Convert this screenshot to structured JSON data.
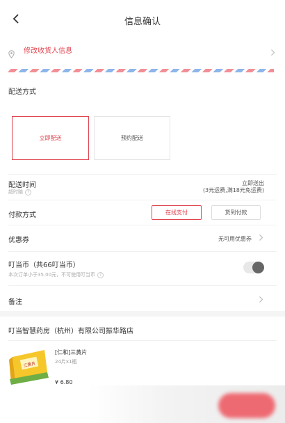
{
  "header": {
    "title": "信息确认",
    "back_icon": "chevron-left-icon"
  },
  "address": {
    "label": "修改收货人信息",
    "icon": "location-pin-icon"
  },
  "delivery": {
    "section_title": "配送方式",
    "options": [
      {
        "label": "立即配送",
        "selected": true
      },
      {
        "label": "预约配送",
        "selected": false
      }
    ]
  },
  "delivery_time": {
    "label": "配送时间",
    "sub_label": "超时赔",
    "value": "立即送出",
    "fee_note": "(3元运费,满18元免运费)"
  },
  "payment": {
    "label": "付款方式",
    "options": [
      {
        "label": "在线支付",
        "selected": true
      },
      {
        "label": "货到付款",
        "selected": false
      }
    ]
  },
  "coupon": {
    "label": "优惠券",
    "value": "无可用优惠券"
  },
  "coins": {
    "label": "叮当币（共66叮当币）",
    "note": "本次订单小于35.00元，不可使用叮当币",
    "enabled": false
  },
  "remark": {
    "label": "备注"
  },
  "store": {
    "name": "叮当智慧药房（杭州）有限公司振华路店"
  },
  "product": {
    "name": "[仁和]三黄片",
    "spec": "24片x1瓶",
    "price": "¥ 6.80",
    "box_text": "三黄片"
  },
  "colors": {
    "accent": "#e0444f",
    "submit": "#ee6a72"
  }
}
